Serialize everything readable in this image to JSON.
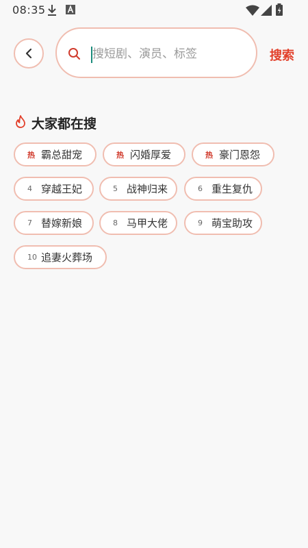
{
  "status_bar": {
    "time": "08:35",
    "icons": [
      "download-icon",
      "font-a-icon",
      "wifi-icon",
      "signal-icon",
      "battery-charging-icon"
    ]
  },
  "search": {
    "placeholder": "搜短剧、演员、标签",
    "value": "",
    "submit_label": "搜索"
  },
  "trending": {
    "title": "大家都在搜",
    "icon": "fire-icon",
    "items": [
      {
        "rank": "热",
        "label": "霸总甜宠"
      },
      {
        "rank": "热",
        "label": "闪婚厚爱"
      },
      {
        "rank": "热",
        "label": "豪门恩怨"
      },
      {
        "rank": "4",
        "label": "穿越王妃"
      },
      {
        "rank": "5",
        "label": "战神归来"
      },
      {
        "rank": "6",
        "label": "重生复仇"
      },
      {
        "rank": "7",
        "label": "替嫁新娘"
      },
      {
        "rank": "8",
        "label": "马甲大佬"
      },
      {
        "rank": "9",
        "label": "萌宝助攻"
      },
      {
        "rank": "10",
        "label": "追妻火葬场"
      }
    ]
  },
  "colors": {
    "accent": "#e2402b",
    "border": "#f0bdb0",
    "background": "#f8f8f8"
  }
}
